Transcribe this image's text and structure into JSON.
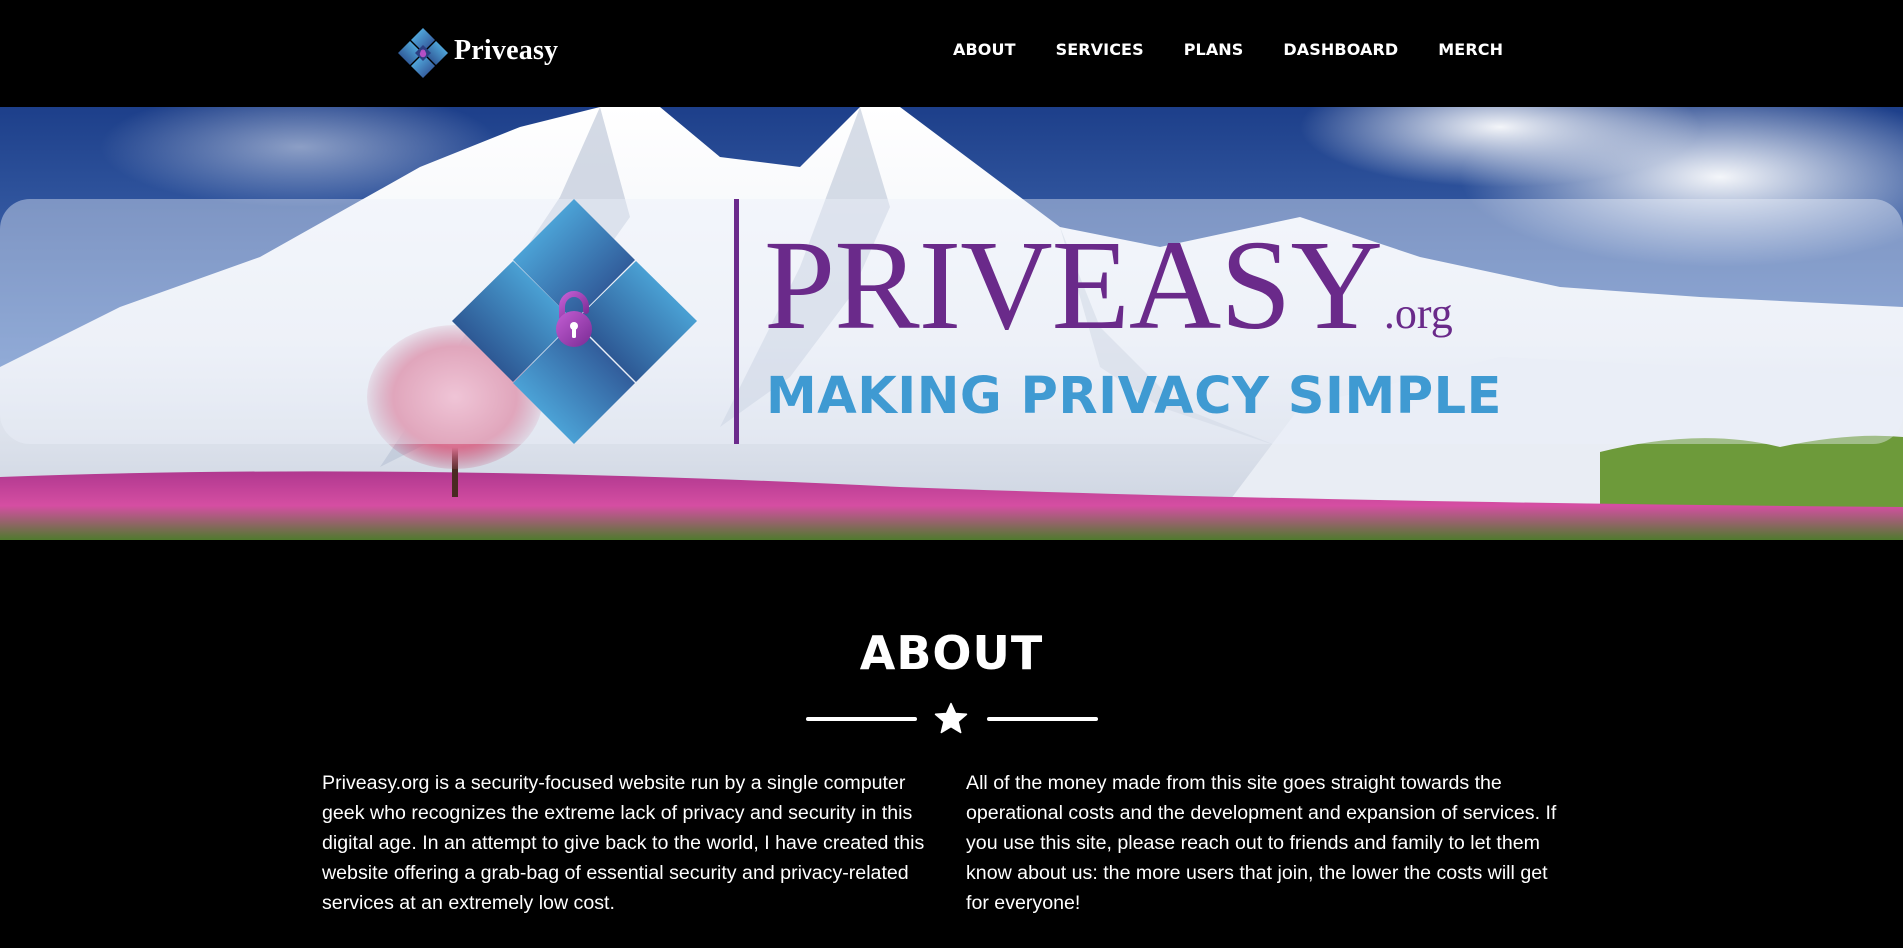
{
  "brand": {
    "name": "Priveasy"
  },
  "nav": {
    "items": [
      {
        "label": "ABOUT"
      },
      {
        "label": "SERVICES"
      },
      {
        "label": "PLANS"
      },
      {
        "label": "DASHBOARD"
      },
      {
        "label": "MERCH"
      }
    ]
  },
  "hero": {
    "wordmark": "PRIVEASY",
    "wordmark_suffix": ".org",
    "tagline": "MAKING PRIVACY SIMPLE"
  },
  "about": {
    "title": "ABOUT",
    "paragraphs": [
      "Priveasy.org is a security-focused website run by a single computer geek who recognizes the extreme lack of privacy and security in this digital age. In an attempt to give back to the world, I have created this website offering a grab-bag of essential security and privacy-related services at an extremely low cost.",
      "All of the money made from this site goes straight towards the operational costs and the development and expansion of services. If you use this site, please reach out to friends and family to let them know about us: the more users that join, the lower the costs will get for everyone!"
    ]
  },
  "colors": {
    "background": "#000000",
    "brand_purple": "#6a2a8a",
    "brand_blue": "#3f9ad2",
    "text": "#ffffff"
  },
  "icons": {
    "brand_logo": "priveasy-diamond-lock-icon",
    "hero_logo": "priveasy-diamond-lock-icon",
    "divider": "star-icon"
  }
}
